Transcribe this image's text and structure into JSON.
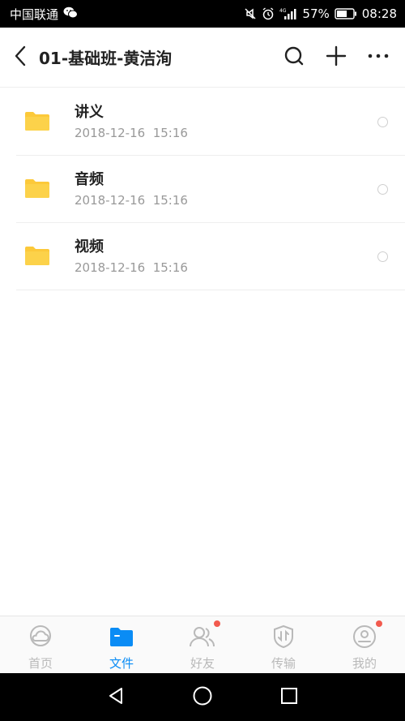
{
  "status_bar": {
    "carrier": "中国联通",
    "battery": "57%",
    "time": "08:28",
    "icons": [
      "wechat-icon",
      "mute-icon",
      "alarm-icon",
      "signal-4g-icon",
      "battery-icon"
    ]
  },
  "header": {
    "title": "01-基础班-黄洁洵",
    "icons": [
      "back-arrow-icon",
      "search-icon",
      "plus-icon",
      "more-icon"
    ]
  },
  "files": [
    {
      "name": "讲义",
      "date": "2018-12-16  15:16",
      "icon": "folder-icon"
    },
    {
      "name": "音频",
      "date": "2018-12-16  15:16",
      "icon": "folder-icon"
    },
    {
      "name": "视频",
      "date": "2018-12-16  15:16",
      "icon": "folder-icon"
    }
  ],
  "tabs": [
    {
      "label": "首页",
      "icon": "cloud-icon",
      "active": false,
      "badge": false
    },
    {
      "label": "文件",
      "icon": "folder-tab-icon",
      "active": true,
      "badge": false
    },
    {
      "label": "好友",
      "icon": "friends-icon",
      "active": false,
      "badge": true
    },
    {
      "label": "传输",
      "icon": "transfer-icon",
      "active": false,
      "badge": false
    },
    {
      "label": "我的",
      "icon": "profile-icon",
      "active": false,
      "badge": true
    }
  ],
  "colors": {
    "accent": "#0a8cf5",
    "folder": "#fcc93a",
    "badge": "#f25a4e",
    "inactive_tab": "#b9b9b9"
  },
  "nav_bar": {
    "icons": [
      "back-triangle-icon",
      "home-circle-icon",
      "recents-square-icon"
    ]
  }
}
